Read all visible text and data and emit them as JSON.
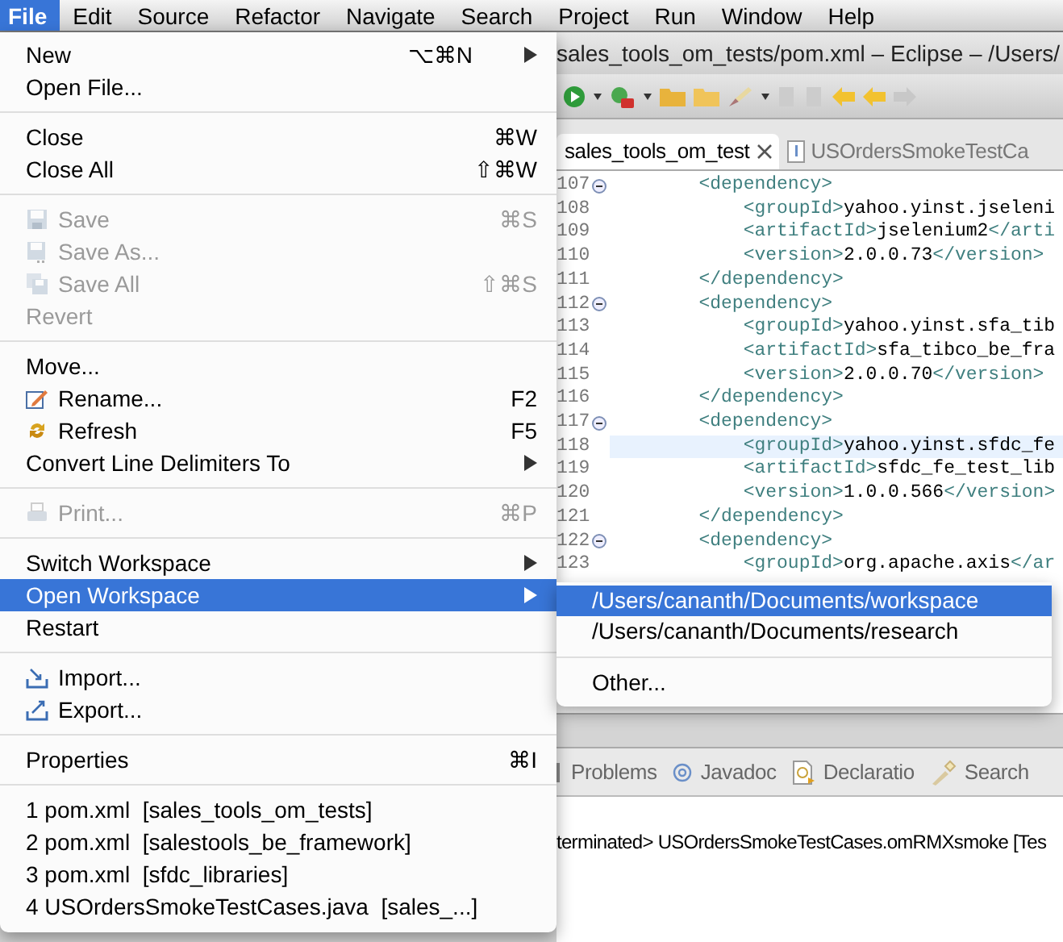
{
  "menu_bar": [
    {
      "label": "File",
      "selected": true
    },
    {
      "label": "Edit",
      "selected": false
    },
    {
      "label": "Source",
      "selected": false
    },
    {
      "label": "Refactor",
      "selected": false
    },
    {
      "label": "Navigate",
      "selected": false
    },
    {
      "label": "Search",
      "selected": false
    },
    {
      "label": "Project",
      "selected": false
    },
    {
      "label": "Run",
      "selected": false
    },
    {
      "label": "Window",
      "selected": false
    },
    {
      "label": "Help",
      "selected": false
    }
  ],
  "window": {
    "title": "sales_tools_om_tests/pom.xml – Eclipse – /Users/"
  },
  "editor_tabs": [
    {
      "label": "sales_tools_om_test",
      "selected": true,
      "kind": "xml"
    },
    {
      "label": "USOrdersSmokeTestCa",
      "selected": false,
      "kind": "java"
    }
  ],
  "code_lines": [
    {
      "number": "107",
      "fold": true,
      "current": false,
      "text": "        <dependency>"
    },
    {
      "number": "108",
      "fold": false,
      "current": false,
      "text": "            <groupId>yahoo.yinst.jseleni"
    },
    {
      "number": "109",
      "fold": false,
      "current": false,
      "text": "            <artifactId>jselenium2</arti"
    },
    {
      "number": "110",
      "fold": false,
      "current": false,
      "text": "            <version>2.0.0.73</version>"
    },
    {
      "number": "111",
      "fold": false,
      "current": false,
      "text": "        </dependency>"
    },
    {
      "number": "112",
      "fold": true,
      "current": false,
      "text": "        <dependency>"
    },
    {
      "number": "113",
      "fold": false,
      "current": false,
      "text": "            <groupId>yahoo.yinst.sfa_tib"
    },
    {
      "number": "114",
      "fold": false,
      "current": false,
      "text": "            <artifactId>sfa_tibco_be_fra"
    },
    {
      "number": "115",
      "fold": false,
      "current": false,
      "text": "            <version>2.0.0.70</version>"
    },
    {
      "number": "116",
      "fold": false,
      "current": false,
      "text": "        </dependency>"
    },
    {
      "number": "117",
      "fold": true,
      "current": false,
      "text": "        <dependency>"
    },
    {
      "number": "118",
      "fold": false,
      "current": true,
      "text": "            <groupId>yahoo.yinst.sfdc_fe"
    },
    {
      "number": "119",
      "fold": false,
      "current": false,
      "text": "            <artifactId>sfdc_fe_test_lib"
    },
    {
      "number": "120",
      "fold": false,
      "current": false,
      "text": "            <version>1.0.0.566</version>"
    },
    {
      "number": "121",
      "fold": false,
      "current": false,
      "text": "        </dependency>"
    },
    {
      "number": "122",
      "fold": true,
      "current": false,
      "text": "        <dependency>"
    },
    {
      "number": "123",
      "fold": false,
      "current": false,
      "text": "            <groupId>org.apache.axis</ar"
    }
  ],
  "bottom_tabs": [
    {
      "label": "Problems",
      "kind": "problems"
    },
    {
      "label": "Javadoc",
      "kind": "javadoc"
    },
    {
      "label": "Declaratio",
      "kind": "declaration"
    },
    {
      "label": "Search",
      "kind": "search"
    }
  ],
  "console": {
    "text": "terminated> USOrdersSmokeTestCases.omRMXsmoke [Tes"
  },
  "file_menu": {
    "items": [
      {
        "kind": "item",
        "label": "New",
        "shortcut": "⌥⌘N",
        "submenu": true,
        "disabled": false,
        "selected": false
      },
      {
        "kind": "item",
        "label": "Open File...",
        "submenu": false,
        "disabled": false,
        "selected": false
      },
      {
        "kind": "separator"
      },
      {
        "kind": "item",
        "label": "Close",
        "shortcut": "⌘W",
        "submenu": false,
        "disabled": false,
        "selected": false
      },
      {
        "kind": "item",
        "label": "Close All",
        "shortcut": "⇧⌘W",
        "submenu": false,
        "disabled": false,
        "selected": false
      },
      {
        "kind": "separator"
      },
      {
        "kind": "item",
        "label": "Save",
        "shortcut": "⌘S",
        "submenu": false,
        "disabled": true,
        "selected": false
      },
      {
        "kind": "item",
        "label": "Save As...",
        "submenu": false,
        "disabled": true,
        "selected": false
      },
      {
        "kind": "item",
        "label": "Save All",
        "shortcut": "⇧⌘S",
        "submenu": false,
        "disabled": true,
        "selected": false
      },
      {
        "kind": "item",
        "label": "Revert",
        "submenu": false,
        "disabled": true,
        "selected": false
      },
      {
        "kind": "separator"
      },
      {
        "kind": "item",
        "label": "Move...",
        "submenu": false,
        "disabled": false,
        "selected": false
      },
      {
        "kind": "item",
        "label": "Rename...",
        "shortcut": "F2",
        "submenu": false,
        "disabled": false,
        "selected": false
      },
      {
        "kind": "item",
        "label": "Refresh",
        "shortcut": "F5",
        "submenu": false,
        "disabled": false,
        "selected": false
      },
      {
        "kind": "item",
        "label": "Convert Line Delimiters To",
        "submenu": true,
        "disabled": false,
        "selected": false
      },
      {
        "kind": "separator"
      },
      {
        "kind": "item",
        "label": "Print...",
        "shortcut": "⌘P",
        "submenu": false,
        "disabled": true,
        "selected": false
      },
      {
        "kind": "separator"
      },
      {
        "kind": "item",
        "label": "Switch Workspace",
        "submenu": true,
        "disabled": false,
        "selected": false
      },
      {
        "kind": "item",
        "label": "Open Workspace",
        "submenu": true,
        "disabled": false,
        "selected": true
      },
      {
        "kind": "item",
        "label": "Restart",
        "submenu": false,
        "disabled": false,
        "selected": false
      },
      {
        "kind": "separator"
      },
      {
        "kind": "item",
        "label": "Import...",
        "submenu": false,
        "disabled": false,
        "selected": false
      },
      {
        "kind": "item",
        "label": "Export...",
        "submenu": false,
        "disabled": false,
        "selected": false
      },
      {
        "kind": "separator"
      },
      {
        "kind": "item",
        "label": "Properties",
        "shortcut": "⌘I",
        "submenu": false,
        "disabled": false,
        "selected": false
      },
      {
        "kind": "separator"
      },
      {
        "kind": "item",
        "label": "1 pom.xml  [sales_tools_om_tests]",
        "submenu": false,
        "disabled": false,
        "selected": false
      },
      {
        "kind": "item",
        "label": "2 pom.xml  [salestools_be_framework]",
        "submenu": false,
        "disabled": false,
        "selected": false
      },
      {
        "kind": "item",
        "label": "3 pom.xml  [sfdc_libraries]",
        "submenu": false,
        "disabled": false,
        "selected": false
      },
      {
        "kind": "item",
        "label": "4 USOrdersSmokeTestCases.java  [sales_...]",
        "submenu": false,
        "disabled": false,
        "selected": false
      }
    ]
  },
  "open_workspace_submenu": {
    "items": [
      {
        "kind": "item",
        "label": "/Users/cananth/Documents/workspace",
        "selected": true
      },
      {
        "kind": "item",
        "label": "/Users/cananth/Documents/research",
        "selected": false
      },
      {
        "kind": "separator"
      },
      {
        "kind": "item",
        "label": "Other...",
        "selected": false
      }
    ]
  }
}
